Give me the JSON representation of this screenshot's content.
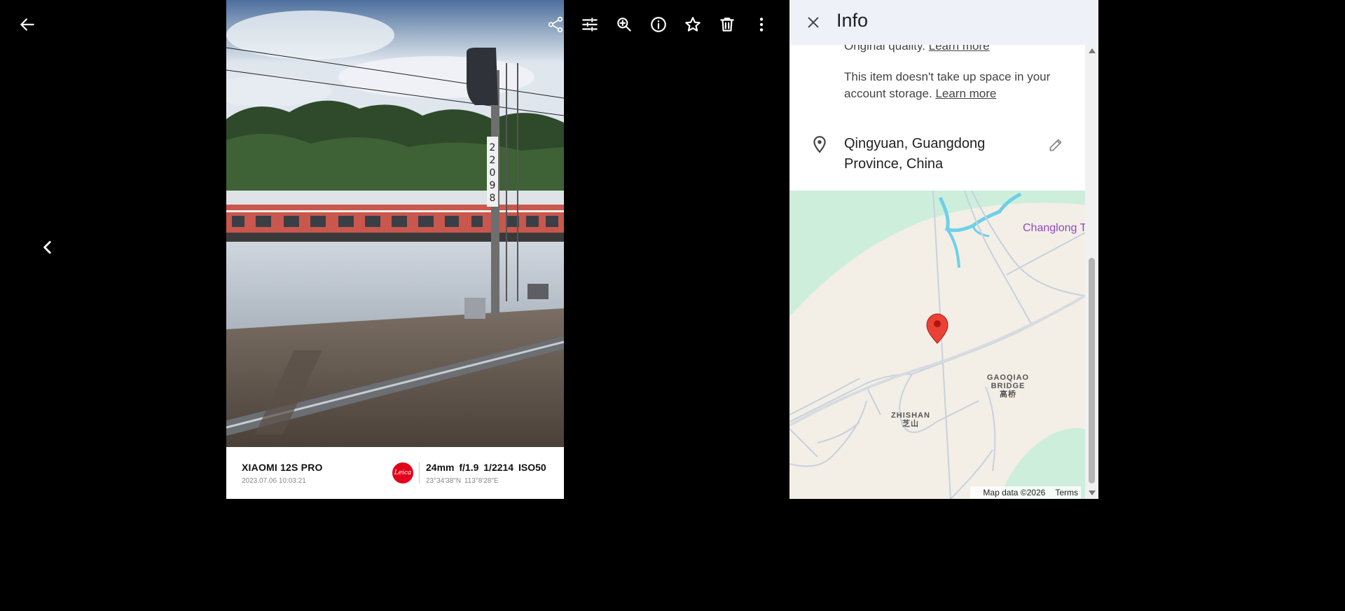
{
  "viewer": {
    "back_icon": "arrow-left-icon",
    "prev_icon": "chevron-left-icon",
    "toolbar": [
      "share-icon",
      "tune-icon",
      "zoom-in-icon",
      "info-icon",
      "star-icon",
      "delete-icon",
      "more-vert-icon"
    ]
  },
  "photo": {
    "pole_number": "22098",
    "watermark": {
      "model": "XIAOMI 12S PRO",
      "datetime": "2023.07.06 10:03:21",
      "brand": "Leica",
      "params": "24mm  f/1.9  1/2214  ISO50",
      "coords": "23°34'38\"N  113°8'28\"E"
    }
  },
  "info": {
    "title": "Info",
    "close_icon": "close-icon",
    "quality_text": "Original quality.",
    "quality_link": "Learn more",
    "storage_line1": "This item doesn't take up space in your",
    "storage_line2": "account storage.",
    "storage_link": "Learn more",
    "location": "Qingyuan, Guangdong Province, China",
    "location_icon": "location-pin-icon",
    "edit_icon": "pencil-icon",
    "map": {
      "labels": {
        "changlong": "Changlong T",
        "gaoqiao": "GAOQIAO BRIDGE",
        "gaoqiao_cn": "高桥",
        "zhishan": "ZHISHAN",
        "zhishan_cn": "芝山"
      },
      "copyright": "Map data ©2026",
      "terms": "Terms",
      "marker_color": "#ea4335"
    }
  }
}
